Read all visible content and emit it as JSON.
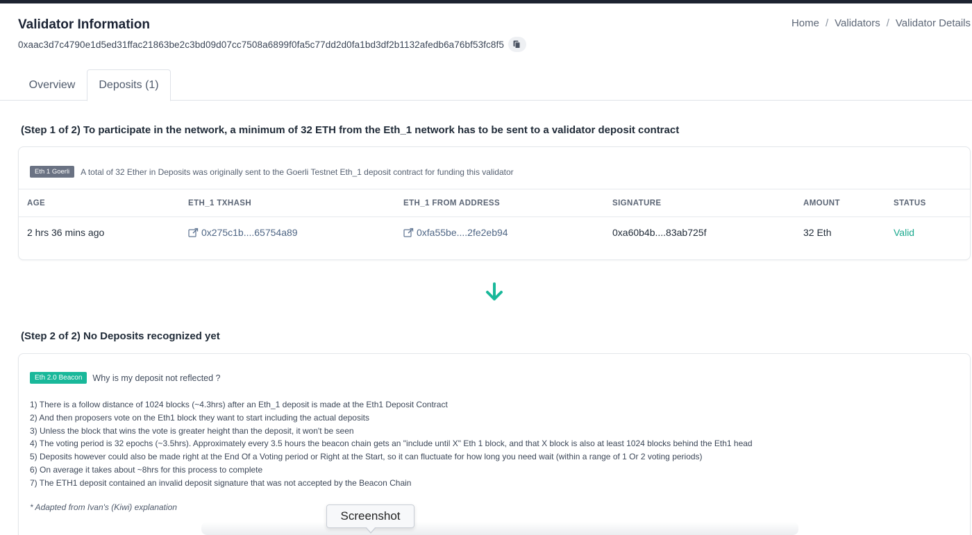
{
  "header": {
    "title": "Validator Information",
    "address": "0xaac3d7c4790e1d5ed31ffac21863be2c3bd09d07cc7508a6899f0fa5c77dd2d0fa1bd3df2b1132afedb6a76bf53fc8f5",
    "copy_icon": "copy-icon"
  },
  "breadcrumb": [
    "Home",
    "Validators",
    "Validator Details"
  ],
  "tabs": [
    {
      "label": "Overview",
      "active": false
    },
    {
      "label": "Deposits (1)",
      "active": true
    }
  ],
  "step1": {
    "title": "(Step 1 of 2) To participate in the network, a minimum of 32 ETH from the Eth_1 network has to be sent to a validator deposit contract",
    "badge": "Eth 1 Goerli",
    "description": "A total of 32 Ether in Deposits was originally sent to the Goerli Testnet Eth_1 deposit contract for funding this validator",
    "columns": [
      "AGE",
      "ETH_1 TXHASH",
      "ETH_1 FROM ADDRESS",
      "SIGNATURE",
      "AMOUNT",
      "STATUS"
    ],
    "rows": [
      {
        "age": "2 hrs 36 mins ago",
        "txhash": "0x275c1b....65754a89",
        "from": "0xfa55be....2fe2eb94",
        "signature": "0xa60b4b....83ab725f",
        "amount": "32 Eth",
        "status": "Valid"
      }
    ]
  },
  "step2": {
    "title": "(Step 2 of 2) No Deposits recognized yet",
    "badge": "Eth 2.0 Beacon",
    "question": "Why is my deposit not reflected ?",
    "reasons": [
      "1) There is a follow distance of 1024 blocks (~4.3hrs) after an Eth_1 deposit is made at the Eth1 Deposit Contract",
      "2) And then proposers vote on the Eth1 block they want to start including the actual deposits",
      "3) Unless the block that wins the vote is greater height than the deposit, it won't be seen",
      "4) The voting period is 32 epochs (~3.5hrs). Approximately every 3.5 hours the beacon chain gets an \"include until X\" Eth 1 block, and that X block is also at least 1024 blocks behind the Eth1 head",
      "5) Deposits however could also be made right at the End Of a Voting period or Right at the Start, so it can fluctuate for how long you need wait (within a range of 1 Or 2 voting periods)",
      "6) On average it takes about ~8hrs for this process to complete",
      "7) The ETH1 deposit contained an invalid deposit signature that was not accepted by the Beacon Chain"
    ],
    "footnote": "* Adapted from Ivan's (Kiwi) explanation"
  },
  "tooltip": "Screenshot",
  "colors": {
    "accent_green": "#19b89a",
    "badge_grey": "#6a7283",
    "link": "#4f6685",
    "valid": "#19a88d"
  }
}
